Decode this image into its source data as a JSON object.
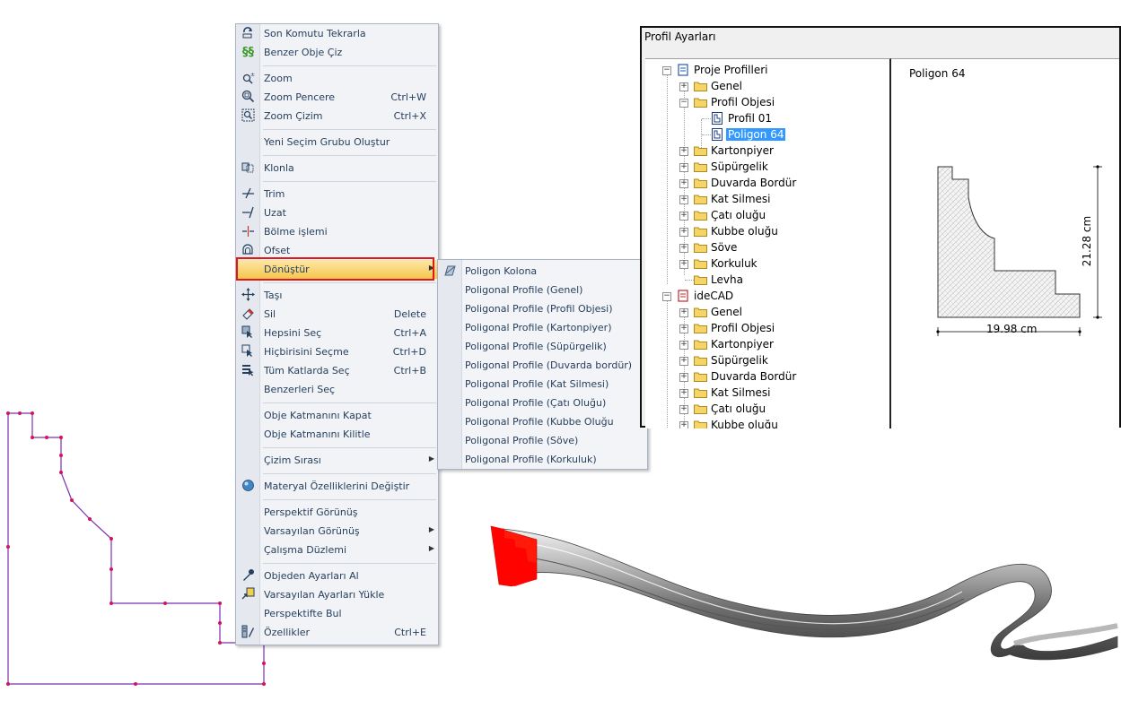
{
  "context_menu": {
    "items": [
      {
        "label": "Son Komutu Tekrarla",
        "shortcut": "",
        "icon": "repeat-icon"
      },
      {
        "label": "Benzer Obje Çiz",
        "shortcut": "",
        "icon": "similar-object-icon"
      },
      {
        "label": "Zoom",
        "shortcut": "",
        "icon": "zoom-icon"
      },
      {
        "label": "Zoom Pencere",
        "shortcut": "Ctrl+W",
        "icon": "zoom-window-icon"
      },
      {
        "label": "Zoom Çizim",
        "shortcut": "Ctrl+X",
        "icon": "zoom-extents-icon"
      },
      {
        "label": "Yeni Seçim Grubu Oluştur",
        "shortcut": "",
        "icon": ""
      },
      {
        "label": "Klonla",
        "shortcut": "",
        "icon": "clone-icon"
      },
      {
        "label": "Trim",
        "shortcut": "",
        "icon": "trim-icon"
      },
      {
        "label": "Uzat",
        "shortcut": "",
        "icon": "extend-icon"
      },
      {
        "label": "Bölme işlemi",
        "shortcut": "",
        "icon": "split-icon"
      },
      {
        "label": "Ofset",
        "shortcut": "",
        "icon": "offset-icon"
      },
      {
        "label": "Dönüştür",
        "shortcut": "",
        "icon": "",
        "submenu": true
      },
      {
        "label": "Taşı",
        "shortcut": "",
        "icon": "move-icon"
      },
      {
        "label": "Sil",
        "shortcut": "Delete",
        "icon": "eraser-icon"
      },
      {
        "label": "Hepsini Seç",
        "shortcut": "Ctrl+A",
        "icon": "select-all-icon"
      },
      {
        "label": "Hiçbirisini Seçme",
        "shortcut": "Ctrl+D",
        "icon": "deselect-icon"
      },
      {
        "label": "Tüm Katlarda Seç",
        "shortcut": "Ctrl+B",
        "icon": "select-all-floors-icon"
      },
      {
        "label": "Benzerleri Seç",
        "shortcut": "",
        "icon": ""
      },
      {
        "label": "Obje Katmanını Kapat",
        "shortcut": "",
        "icon": ""
      },
      {
        "label": "Obje Katmanını Kilitle",
        "shortcut": "",
        "icon": ""
      },
      {
        "label": "Çizim Sırası",
        "shortcut": "",
        "icon": "",
        "submenu": true
      },
      {
        "label": "Materyal Özelliklerini Değiştir",
        "shortcut": "",
        "icon": "material-icon"
      },
      {
        "label": "Perspektif Görünüş",
        "shortcut": "",
        "icon": ""
      },
      {
        "label": "Varsayılan Görünüş",
        "shortcut": "",
        "icon": "",
        "submenu": true
      },
      {
        "label": "Çalışma Düzlemi",
        "shortcut": "",
        "icon": "",
        "submenu": true
      },
      {
        "label": "Objeden Ayarları Al",
        "shortcut": "",
        "icon": "eyedropper-icon"
      },
      {
        "label": "Varsayılan Ayarları Yükle",
        "shortcut": "",
        "icon": "load-defaults-icon"
      },
      {
        "label": "Perspektifte Bul",
        "shortcut": "",
        "icon": ""
      },
      {
        "label": "Özellikler",
        "shortcut": "Ctrl+E",
        "icon": "properties-icon"
      }
    ]
  },
  "submenu": {
    "items": [
      "Poligon Kolona",
      "Poligonal Profile (Genel)",
      "Poligonal Profile (Profil Objesi)",
      "Poligonal Profile (Kartonpiyer)",
      "Poligonal Profile (Süpürgelik)",
      "Poligonal Profile (Duvarda bordür)",
      "Poligonal Profile (Kat Silmesi)",
      "Poligonal Profile (Çatı Oluğu)",
      "Poligonal Profile (Kubbe Oluğu",
      "Poligonal Profile (Söve)",
      "Poligonal Profile (Korkuluk)"
    ]
  },
  "profile_window": {
    "title": "Profil Ayarları",
    "tree": [
      {
        "label": "Proje Profilleri",
        "level": 0,
        "type": "root-blue",
        "expander": "−"
      },
      {
        "label": "Genel",
        "level": 1,
        "type": "folder",
        "expander": "+"
      },
      {
        "label": "Profil Objesi",
        "level": 1,
        "type": "folder",
        "expander": "−"
      },
      {
        "label": "Profil 01",
        "level": 2,
        "type": "profile",
        "expander": ""
      },
      {
        "label": "Poligon 64",
        "level": 2,
        "type": "profile",
        "expander": "",
        "selected": true
      },
      {
        "label": "Kartonpiyer",
        "level": 1,
        "type": "folder",
        "expander": "+"
      },
      {
        "label": "Süpürgelik",
        "level": 1,
        "type": "folder",
        "expander": "+"
      },
      {
        "label": "Duvarda Bordür",
        "level": 1,
        "type": "folder",
        "expander": "+"
      },
      {
        "label": "Kat Silmesi",
        "level": 1,
        "type": "folder",
        "expander": "+"
      },
      {
        "label": "Çatı oluğu",
        "level": 1,
        "type": "folder",
        "expander": "+"
      },
      {
        "label": "Kubbe oluğu",
        "level": 1,
        "type": "folder",
        "expander": "+"
      },
      {
        "label": "Söve",
        "level": 1,
        "type": "folder",
        "expander": "+"
      },
      {
        "label": "Korkuluk",
        "level": 1,
        "type": "folder",
        "expander": "+"
      },
      {
        "label": "Levha",
        "level": 1,
        "type": "folder",
        "expander": ""
      },
      {
        "label": "ideCAD",
        "level": 0,
        "type": "root-red",
        "expander": "−"
      },
      {
        "label": "Genel",
        "level": 1,
        "type": "folder",
        "expander": "+"
      },
      {
        "label": "Profil Objesi",
        "level": 1,
        "type": "folder",
        "expander": "+"
      },
      {
        "label": "Kartonpiyer",
        "level": 1,
        "type": "folder",
        "expander": "+"
      },
      {
        "label": "Süpürgelik",
        "level": 1,
        "type": "folder",
        "expander": "+"
      },
      {
        "label": "Duvarda Bordür",
        "level": 1,
        "type": "folder",
        "expander": "+"
      },
      {
        "label": "Kat Silmesi",
        "level": 1,
        "type": "folder",
        "expander": "+"
      },
      {
        "label": "Çatı oluğu",
        "level": 1,
        "type": "folder",
        "expander": "+"
      },
      {
        "label": "Kubbe oluğu",
        "level": 1,
        "type": "folder",
        "expander": "+"
      }
    ],
    "preview": {
      "title": "Poligon 64",
      "width_label": "19.98 cm",
      "height_label": "21.28 cm"
    }
  },
  "colors": {
    "menu_highlight": "#f6c64d",
    "callout_red": "#e01818",
    "selection_blue": "#3399ff",
    "polyline_purple": "#7b2fb5",
    "vertex_pink": "#d4145a"
  }
}
